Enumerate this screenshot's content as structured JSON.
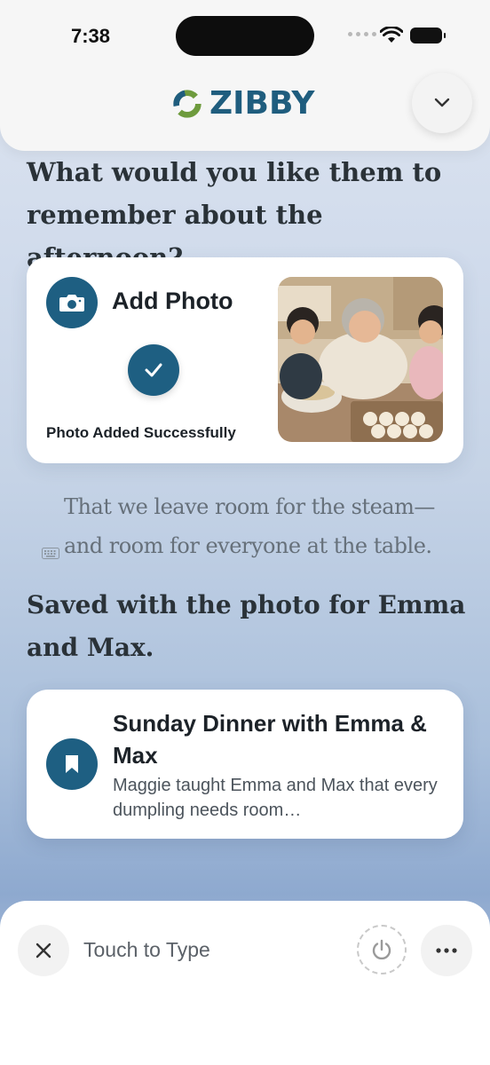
{
  "status_bar": {
    "time": "7:38"
  },
  "header": {
    "brand": "ZIBBY",
    "collapse_icon": "chevron-down-icon"
  },
  "question": "What would you like them to remember about the afternoon?",
  "photo_card": {
    "add_label": "Add Photo",
    "status": "Photo Added Successfully",
    "camera_icon": "camera-icon",
    "check_icon": "check-icon"
  },
  "story_text": {
    "line1": "That we leave room for the steam—",
    "line2": "and room for everyone at the table."
  },
  "saved_message": "Saved with the photo for Emma and Max.",
  "memory_card": {
    "title": "Sunday Dinner with Emma & Max",
    "description": "Maggie taught Emma and Max that every dumpling needs room…",
    "icon": "bookmark-icon"
  },
  "bottom_bar": {
    "prompt": "Touch to Type",
    "close_icon": "close-icon",
    "power_icon": "power-icon",
    "more_icon": "more-icon"
  },
  "colors": {
    "brand": "#1f5d7e",
    "accent": "#1e5f82",
    "logo_green": "#6e9b3d"
  }
}
